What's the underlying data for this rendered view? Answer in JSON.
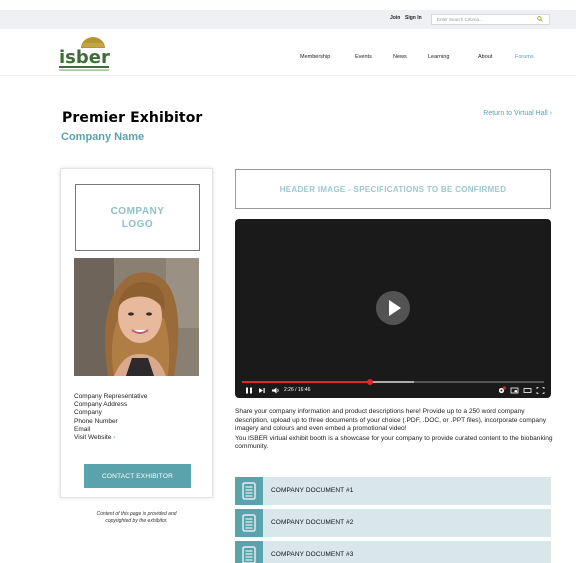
{
  "topbar": {
    "join": "Join",
    "sign_in": "Sign In",
    "search_placeholder": "Enter Search Criteria..."
  },
  "logo": {
    "text": "isber"
  },
  "nav": {
    "items": [
      "Membership",
      "Events",
      "News",
      "Learning",
      "About",
      "Forums"
    ],
    "active": "Forums"
  },
  "page": {
    "title": "Premier Exhibitor",
    "company_name": "Company Name",
    "return_link": "Return to Virtual Hall ›"
  },
  "card": {
    "logo_placeholder": "COMPANY\nLOGO",
    "info": {
      "representative": "Company Representative",
      "address": "Company Address",
      "company": "Company",
      "phone": "Phone Number",
      "email": "Email",
      "website": "Visit Website",
      "website_arrow": "›"
    },
    "contact_button": "CONTACT EXHIBITOR",
    "footnote": "Content of this page is provided and\ncopyrighted by the exhibitor."
  },
  "header_image": {
    "label": "HEADER IMAGE - SPECIFICATIONS TO BE CONFIRMED"
  },
  "video": {
    "time": "2:26 / 16:46",
    "progress": 0.425,
    "buffered": 0.57
  },
  "description": {
    "p1": "Share your company information and product descriptions here! Provide up to a 250 word company description, upload up to three documents of your choice (.PDF, .DOC, or .PPT files), incorporate company imagery and colours and even embed a promotional video!",
    "p2": "You ISBER virtual exhibit booth is a showcase for your company to provide curated content to the biobanking community."
  },
  "documents": [
    {
      "label": "COMPANY DOCUMENT #1"
    },
    {
      "label": "COMPANY DOCUMENT #2"
    },
    {
      "label": "COMPANY DOCUMENT #3"
    }
  ],
  "colors": {
    "accent_teal": "#5aa3ac",
    "logo_green": "#3e6e37",
    "logo_gold": "#b3962f",
    "doc_bg": "#d9e6ea",
    "progress_red": "#e1252b"
  },
  "icons": [
    "search-icon",
    "play-icon",
    "pause-icon",
    "next-icon",
    "volume-icon",
    "settings-icon",
    "miniplayer-icon",
    "theater-icon",
    "fullscreen-icon",
    "document-icon"
  ]
}
